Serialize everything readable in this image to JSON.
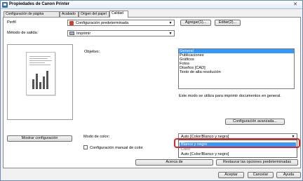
{
  "window": {
    "title": "Propiedades de Canon Printer",
    "close_label": "✕"
  },
  "tabs": [
    {
      "label": "Configuración de página",
      "active": false
    },
    {
      "label": "Acabado",
      "active": false
    },
    {
      "label": "Origen del papel",
      "active": false
    },
    {
      "label": "Calidad",
      "active": true
    }
  ],
  "profile": {
    "label": "Perfil",
    "value": "Configuración predeterminada",
    "add_button": "Agregar(1)...",
    "edit_button": "Editar(2)..."
  },
  "output_method": {
    "label": "Método de salida:",
    "value": "Imprimir"
  },
  "objective": {
    "label": "Objetivo:",
    "items": [
      "General",
      "Publicaciones",
      "Gráficos",
      "Fotos",
      "Diseños [CAD]",
      "Texto de alta resolución"
    ],
    "selected_index": 0,
    "description": "Este modo se utiliza para imprimir documentos en general."
  },
  "advanced_button": "Configuración avanzada...",
  "show_settings_button": "Mostrar configuración",
  "color_mode": {
    "label": "Modo de color:",
    "value": "Auto [Color/Blanco y negro]",
    "options": [
      "Blanco y negro",
      "Color",
      "Auto [Color/Blanco y negro]"
    ],
    "highlighted_index": 0
  },
  "manual_color": {
    "label": "Configuración manual de color",
    "checked": false
  },
  "about_button": "Acerca de",
  "restore_button": "Restaurar las opciones predeterminadas",
  "footer": {
    "ok": "Aceptar",
    "cancel": "Cancelar",
    "help": "Ayuda"
  },
  "colors": {
    "highlight_ring": "#d9262a",
    "selection": "#3399ff",
    "titlebar_border": "#6b8bb3"
  },
  "icons": {
    "app": "printer-icon",
    "profile": "profile-icon",
    "output": "printer-icon"
  }
}
